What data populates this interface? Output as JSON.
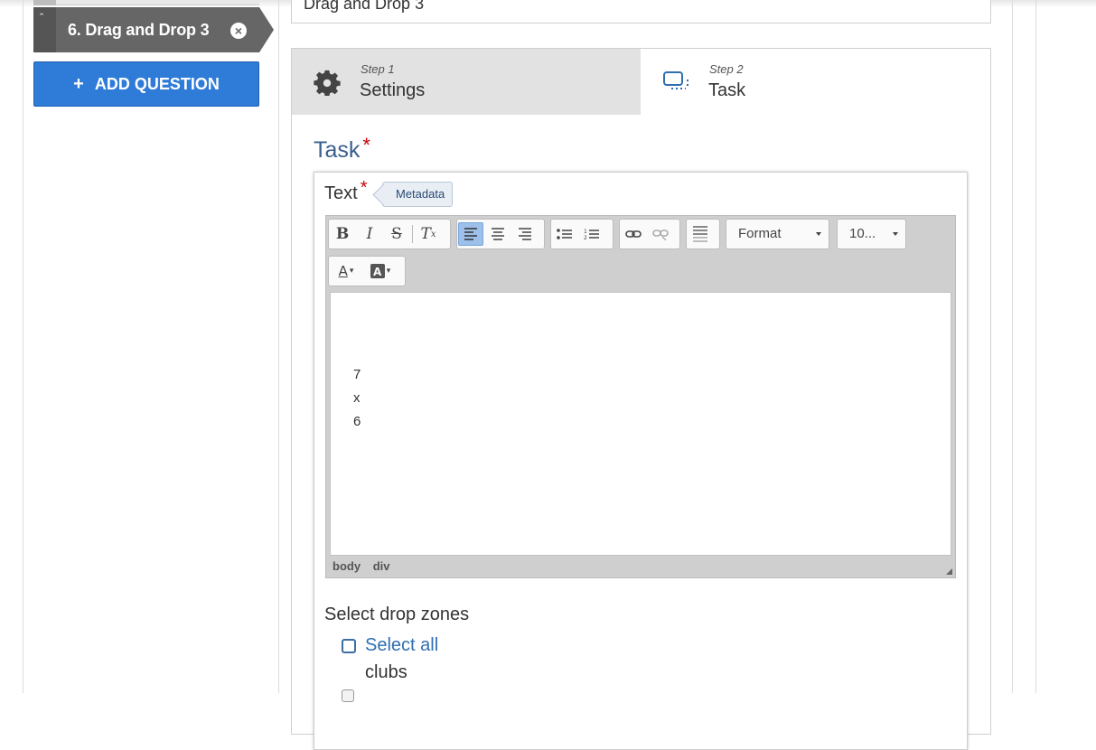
{
  "sidebar": {
    "question_item": {
      "label": "6. Drag and Drop 3"
    },
    "add_question_label": "ADD QUESTION"
  },
  "title_field": {
    "value": "Drag and Drop 3"
  },
  "wizard": {
    "step1": {
      "small": "Step 1",
      "label": "Settings"
    },
    "step2": {
      "small": "Step 2",
      "label": "Task"
    }
  },
  "task": {
    "heading": "Task",
    "required_mark": "*",
    "text_label": "Text",
    "metadata_label": "Metadata",
    "editor": {
      "format_label": "Format",
      "size_label": "10...",
      "content_lines": [
        "7",
        "x",
        "6"
      ],
      "path": [
        "body",
        "div"
      ]
    },
    "drop_zones": {
      "title": "Select drop zones",
      "select_all": "Select all",
      "options": [
        "clubs"
      ]
    }
  },
  "colors": {
    "accent_blue": "#2f7bd8",
    "sidebar_item": "#666666",
    "required_red": "#cc0000",
    "heading_blue": "#3a5f8f"
  }
}
